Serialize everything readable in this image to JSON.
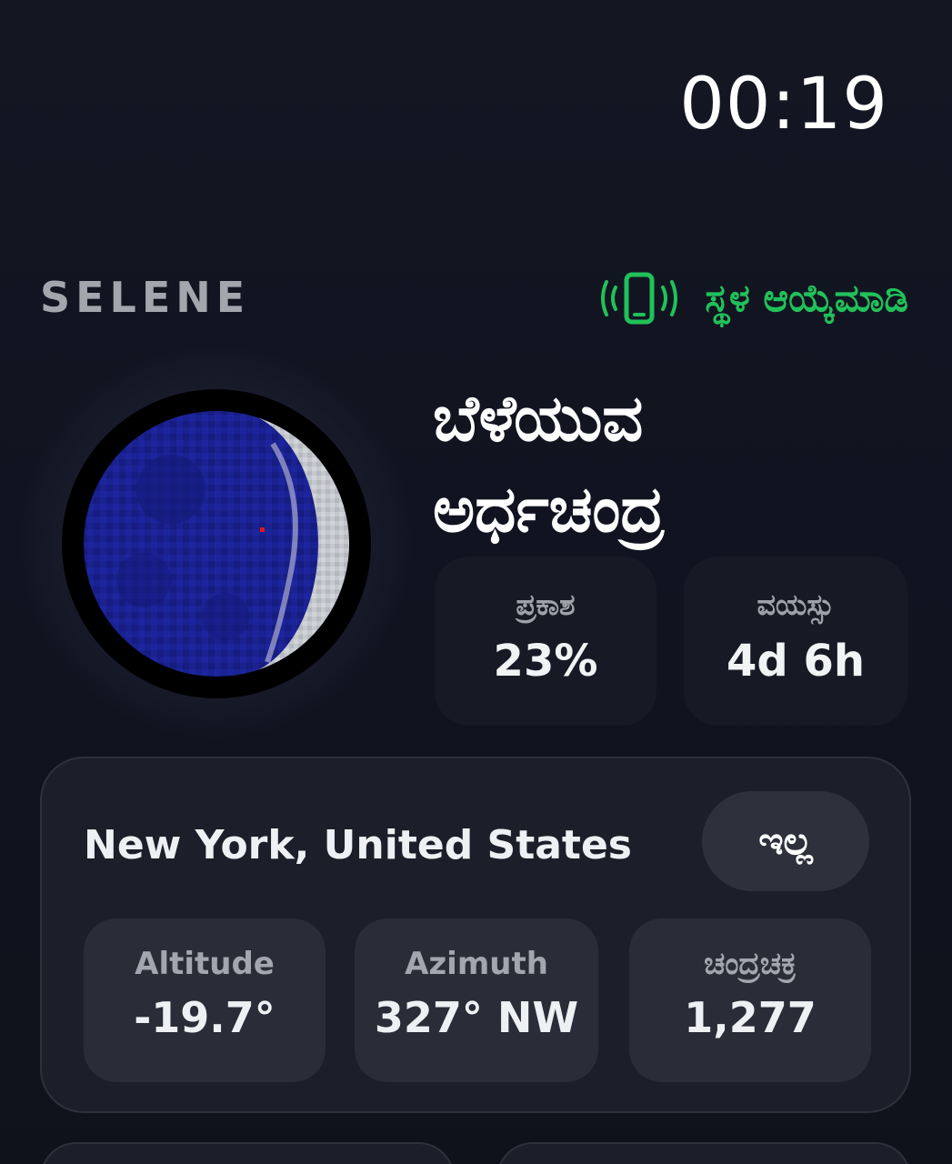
{
  "status": {
    "time": "00:19"
  },
  "header": {
    "brand": "SELENE",
    "locate_icon": "phone-vibrate-icon",
    "locate_label": "ಸ್ಥಳ ಆಯ್ಕೆಮಾಡಿ",
    "accent_color": "#21c15a"
  },
  "moon": {
    "phase_name_line1": "ಬೆಳೆಯುವ",
    "phase_name_line2": "ಅರ್ಧಚಂದ್ರ",
    "illumination_fraction": 0.23
  },
  "stats": {
    "illumination": {
      "label": "ಪ್ರಕಾಶ",
      "value": "23%"
    },
    "age": {
      "label": "ವಯಸ್ಸು",
      "value": "4d 6h"
    }
  },
  "location": {
    "name": "New York, United States",
    "button_label": "ಇಲ್ಲ",
    "altitude": {
      "label": "Altitude",
      "value": "-19.7°"
    },
    "azimuth": {
      "label": "Azimuth",
      "value": "327° NW"
    },
    "cycle": {
      "label": "ಚಂದ್ರಚಕ್ರ",
      "value": "1,277"
    }
  }
}
